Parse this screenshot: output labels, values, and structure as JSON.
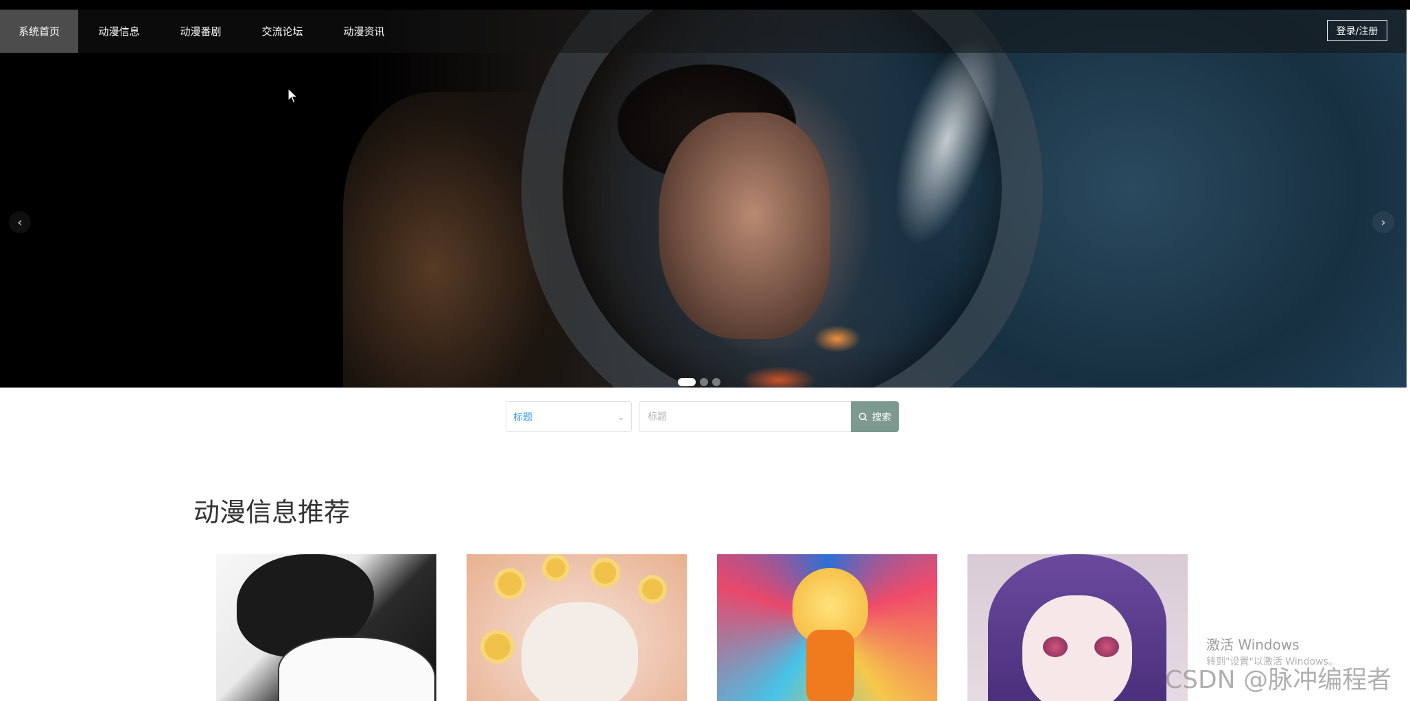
{
  "nav": {
    "items": [
      {
        "label": "系统首页",
        "active": true
      },
      {
        "label": "动漫信息",
        "active": false
      },
      {
        "label": "动漫番剧",
        "active": false
      },
      {
        "label": "交流论坛",
        "active": false
      },
      {
        "label": "动漫资讯",
        "active": false
      }
    ],
    "login_label": "登录/注册"
  },
  "carousel": {
    "prev_icon": "‹",
    "next_icon": "›",
    "slide_count": 3,
    "active_slide": 1
  },
  "search": {
    "select_value": "标题",
    "input_placeholder": "标题",
    "button_label": "搜索",
    "button_color": "#7c9a8f"
  },
  "section": {
    "title": "动漫信息推荐"
  },
  "watermark": {
    "activate_title": "激活 Windows",
    "activate_sub": "转到\"设置\"以激活 Windows。",
    "csdn": "CSDN @脉冲编程者"
  }
}
